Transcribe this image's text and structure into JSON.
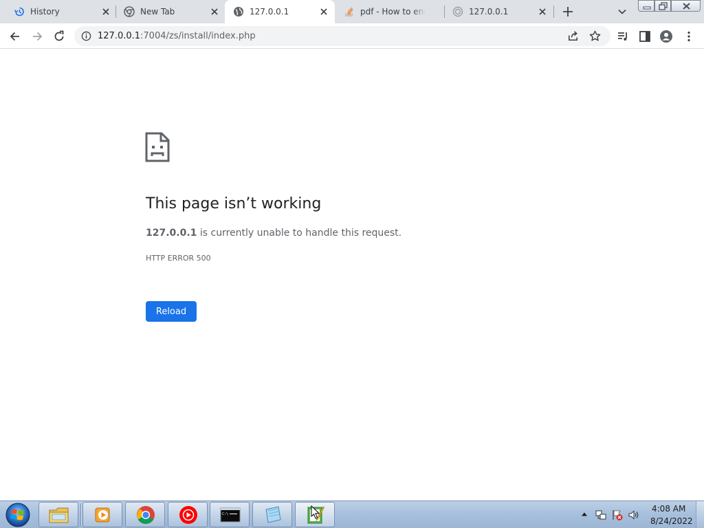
{
  "browser": {
    "tabs": [
      {
        "label": "History",
        "icon": "history-icon",
        "active": false
      },
      {
        "label": "New Tab",
        "icon": "chrome-icon",
        "active": false
      },
      {
        "label": "127.0.0.1",
        "icon": "globe-icon",
        "active": true
      },
      {
        "label": "pdf - How to ena",
        "icon": "stackoverflow-icon",
        "active": false
      },
      {
        "label": "127.0.0.1",
        "icon": "loading-icon",
        "active": false
      }
    ],
    "address": {
      "host": "127.0.0.1",
      "path": ":7004/zs/install/index.php"
    }
  },
  "error_page": {
    "title": "This page isn’t working",
    "host": "127.0.0.1",
    "description": " is currently unable to handle this request.",
    "code": "HTTP ERROR 500",
    "reload_label": "Reload"
  },
  "taskbar": {
    "apps": [
      "windows-explorer",
      "media-player",
      "chrome",
      "youtube-music",
      "command-prompt",
      "notepad",
      "text-editor"
    ],
    "time": "4:08 AM",
    "date": "8/24/2022"
  },
  "colors": {
    "accent": "#1a73e8",
    "tabstrip": "#dee1e6",
    "taskbar": "#a6bfdc"
  }
}
